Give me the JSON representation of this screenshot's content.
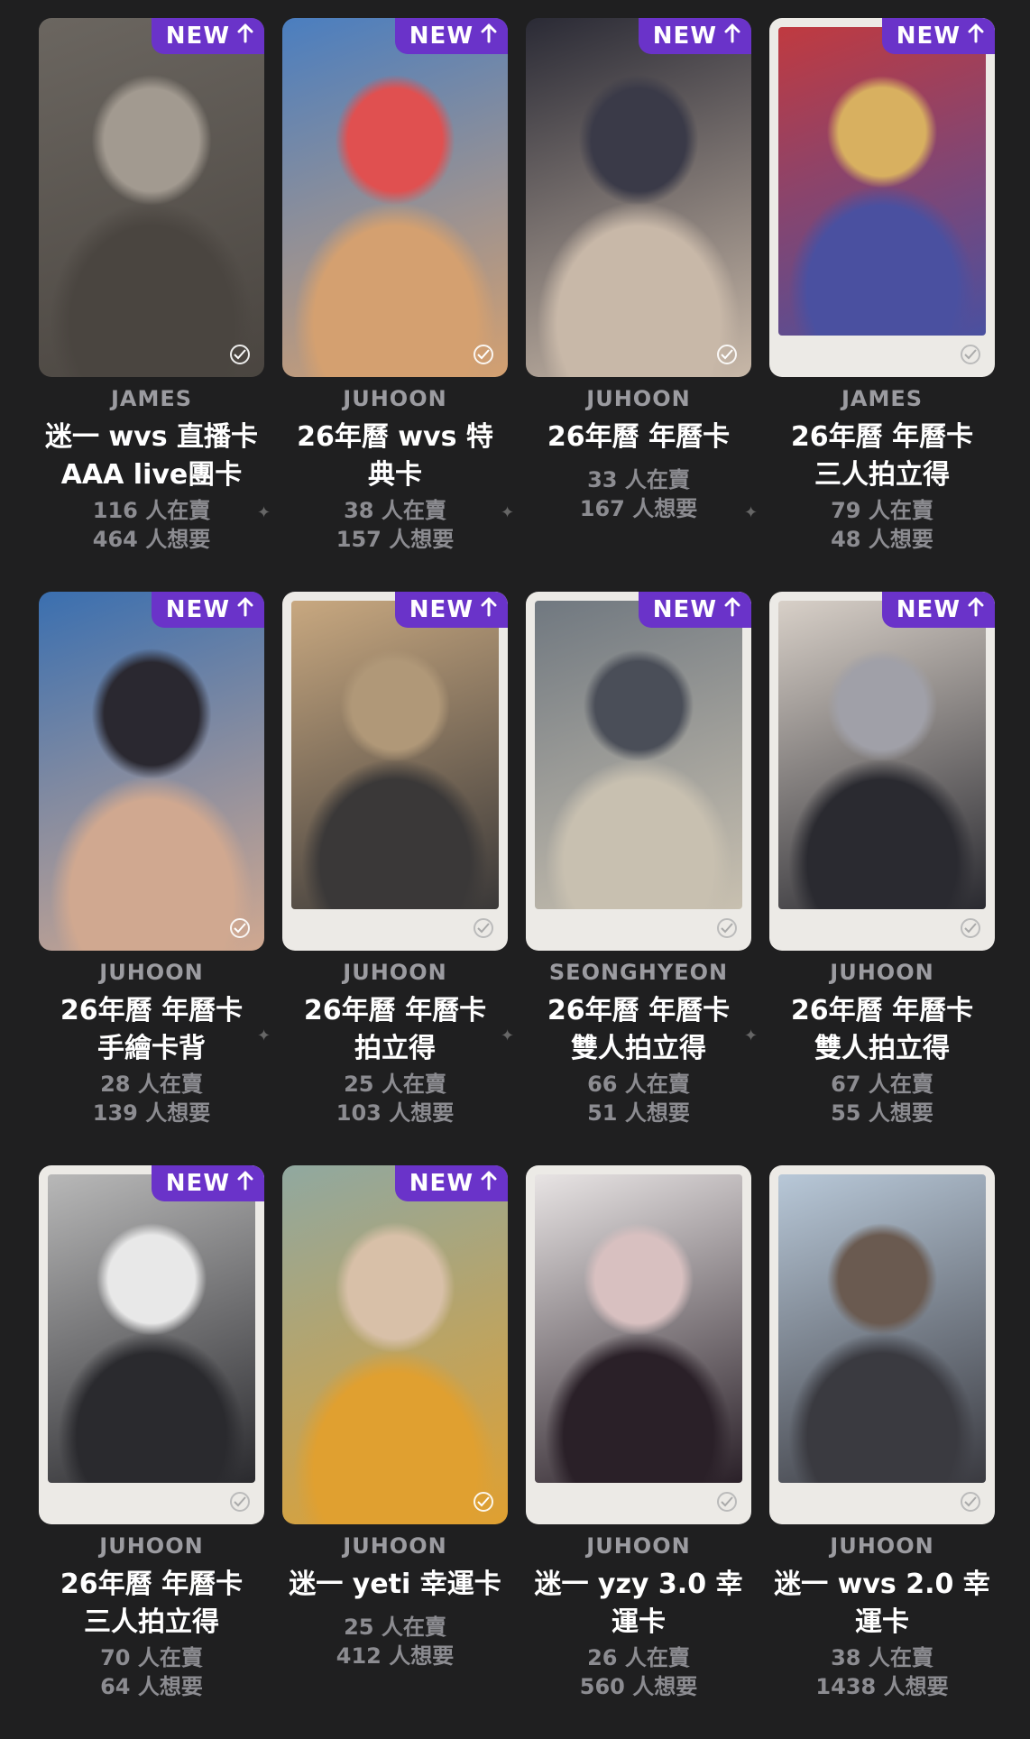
{
  "colors": {
    "background": "#1f1f20",
    "badge": "#6a33c9"
  },
  "badge_label": "NEW",
  "cards": [
    {
      "member": "JAMES",
      "title_line1": "迷一 wvs 直播卡",
      "title_line2": "AAA live團卡",
      "sellers": "116 人在賣",
      "wanted": "464 人想要",
      "is_new": true,
      "frame": "full",
      "colors": [
        "#6b6660",
        "#4a4540",
        "#a29a90"
      ]
    },
    {
      "member": "JUHOON",
      "title_line1": "26年曆 wvs 特",
      "title_line2": "典卡",
      "sellers": "38 人在賣",
      "wanted": "157 人想要",
      "is_new": true,
      "frame": "full",
      "colors": [
        "#4a7ec0",
        "#d4a070",
        "#e05050"
      ]
    },
    {
      "member": "JUHOON",
      "title_line1": "26年曆 年曆卡",
      "title_line2": "",
      "sellers": "33 人在賣",
      "wanted": "167 人想要",
      "is_new": true,
      "frame": "full",
      "colors": [
        "#2a2a35",
        "#c8b8a8",
        "#3a3a48"
      ]
    },
    {
      "member": "JAMES",
      "title_line1": "26年曆 年曆卡",
      "title_line2": "三人拍立得",
      "sellers": "79 人在賣",
      "wanted": "48 人想要",
      "is_new": true,
      "frame": "polaroid",
      "colors": [
        "#c03a40",
        "#4a50a0",
        "#d8b060"
      ]
    },
    {
      "member": "JUHOON",
      "title_line1": "26年曆 年曆卡",
      "title_line2": "手繪卡背",
      "sellers": "28 人在賣",
      "wanted": "139 人想要",
      "is_new": true,
      "frame": "full",
      "colors": [
        "#3a6fb0",
        "#d0a890",
        "#2a2830"
      ]
    },
    {
      "member": "JUHOON",
      "title_line1": "26年曆 年曆卡",
      "title_line2": "拍立得",
      "sellers": "25 人在賣",
      "wanted": "103 人想要",
      "is_new": true,
      "frame": "polaroid",
      "colors": [
        "#c8a880",
        "#3a3838",
        "#b09878"
      ]
    },
    {
      "member": "SEONGHYEON",
      "title_line1": "26年曆 年曆卡",
      "title_line2": "雙人拍立得",
      "sellers": "66 人在賣",
      "wanted": "51 人想要",
      "is_new": true,
      "frame": "polaroid",
      "colors": [
        "#707880",
        "#c8c0b0",
        "#4a4e58"
      ]
    },
    {
      "member": "JUHOON",
      "title_line1": "26年曆 年曆卡",
      "title_line2": "雙人拍立得",
      "sellers": "67 人在賣",
      "wanted": "55 人想要",
      "is_new": true,
      "frame": "polaroid",
      "colors": [
        "#d8d0c8",
        "#2a2a30",
        "#a0a0a8"
      ]
    },
    {
      "member": "JUHOON",
      "title_line1": "26年曆 年曆卡",
      "title_line2": "三人拍立得",
      "sellers": "70 人在賣",
      "wanted": "64 人想要",
      "is_new": true,
      "frame": "polaroid",
      "colors": [
        "#b8b8b8",
        "#2a2a2e",
        "#e8e8e8"
      ]
    },
    {
      "member": "JUHOON",
      "title_line1": "迷一 yeti 幸運卡",
      "title_line2": "",
      "sellers": "25 人在賣",
      "wanted": "412 人想要",
      "is_new": true,
      "frame": "full",
      "colors": [
        "#90a8a0",
        "#e0a030",
        "#d8c0a8"
      ]
    },
    {
      "member": "JUHOON",
      "title_line1": "迷一 yzy 3.0 幸",
      "title_line2": "運卡",
      "sellers": "26 人在賣",
      "wanted": "560 人想要",
      "is_new": false,
      "frame": "polaroid",
      "colors": [
        "#e8e4e4",
        "#2a2028",
        "#d8c0c0"
      ]
    },
    {
      "member": "JUHOON",
      "title_line1": "迷一 wvs 2.0 幸",
      "title_line2": "運卡",
      "sellers": "38 人在賣",
      "wanted": "1438 人想要",
      "is_new": false,
      "frame": "polaroid",
      "colors": [
        "#b8c8d8",
        "#3a3a40",
        "#6a5a50"
      ]
    }
  ]
}
